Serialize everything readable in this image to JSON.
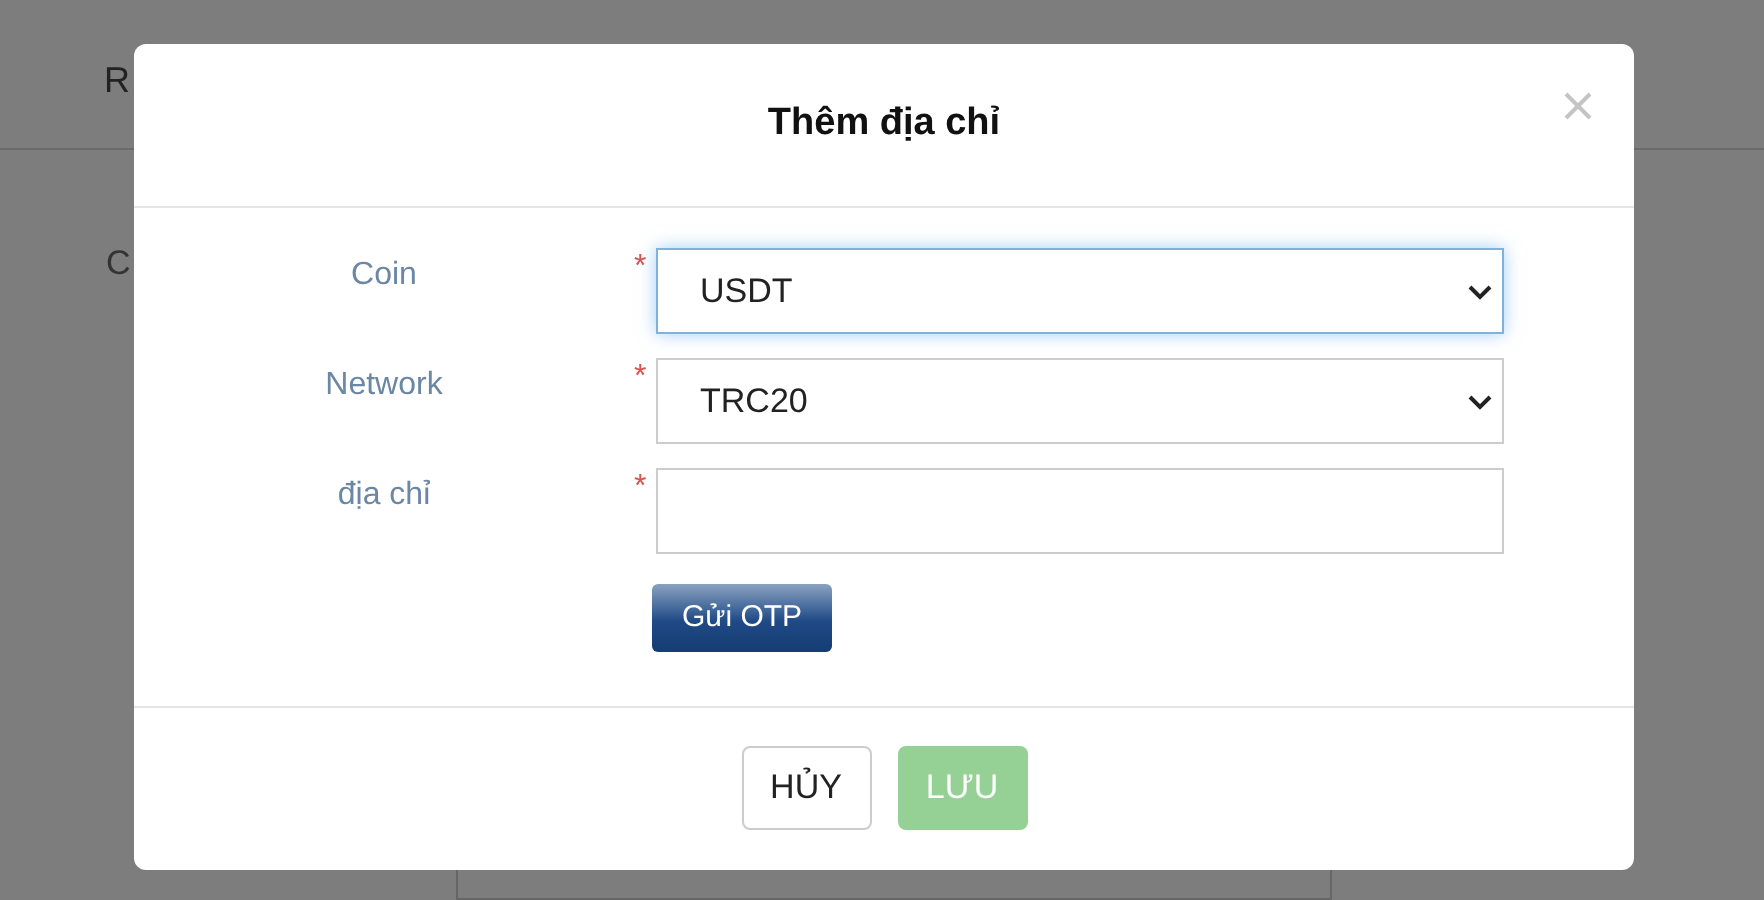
{
  "page": {
    "header_text": "R",
    "section_text": "C"
  },
  "dialog": {
    "title": "Thêm địa chỉ",
    "fields": [
      {
        "kind": "select",
        "label": "Coin",
        "required_mark": "*",
        "value": "USDT",
        "focused": true
      },
      {
        "kind": "select",
        "label": "Network",
        "required_mark": "*",
        "value": "TRC20",
        "focused": false
      },
      {
        "kind": "text",
        "label": "địa chỉ",
        "required_mark": "*",
        "focused": false
      }
    ],
    "otp_button": "Gửi OTP",
    "buttons": [
      {
        "kind": "cancel",
        "label": "HỦY",
        "disabled": false
      },
      {
        "kind": "save",
        "label": "LƯU",
        "disabled": true
      }
    ]
  }
}
